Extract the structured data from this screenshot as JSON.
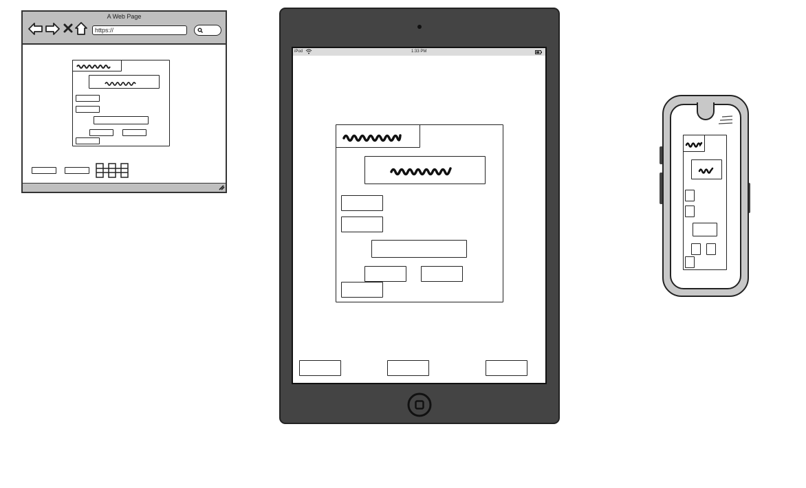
{
  "browser": {
    "title": "A Web Page",
    "url": "https://",
    "icons": [
      "back-arrow-icon",
      "forward-arrow-icon",
      "close-icon",
      "home-icon",
      "search-icon",
      "resize-grip-icon"
    ]
  },
  "ipad": {
    "status_left": "iPod",
    "status_time": "1:33 PM",
    "icons": [
      "wifi-icon",
      "battery-icon",
      "home-button-icon",
      "camera-icon"
    ]
  },
  "phone": {
    "icons": [
      "menu-icon"
    ]
  },
  "colors": {
    "stroke": "#222222",
    "device_body": "#444444",
    "browser_chrome": "#bfbfbf",
    "phone_body": "#c8c8c8"
  }
}
